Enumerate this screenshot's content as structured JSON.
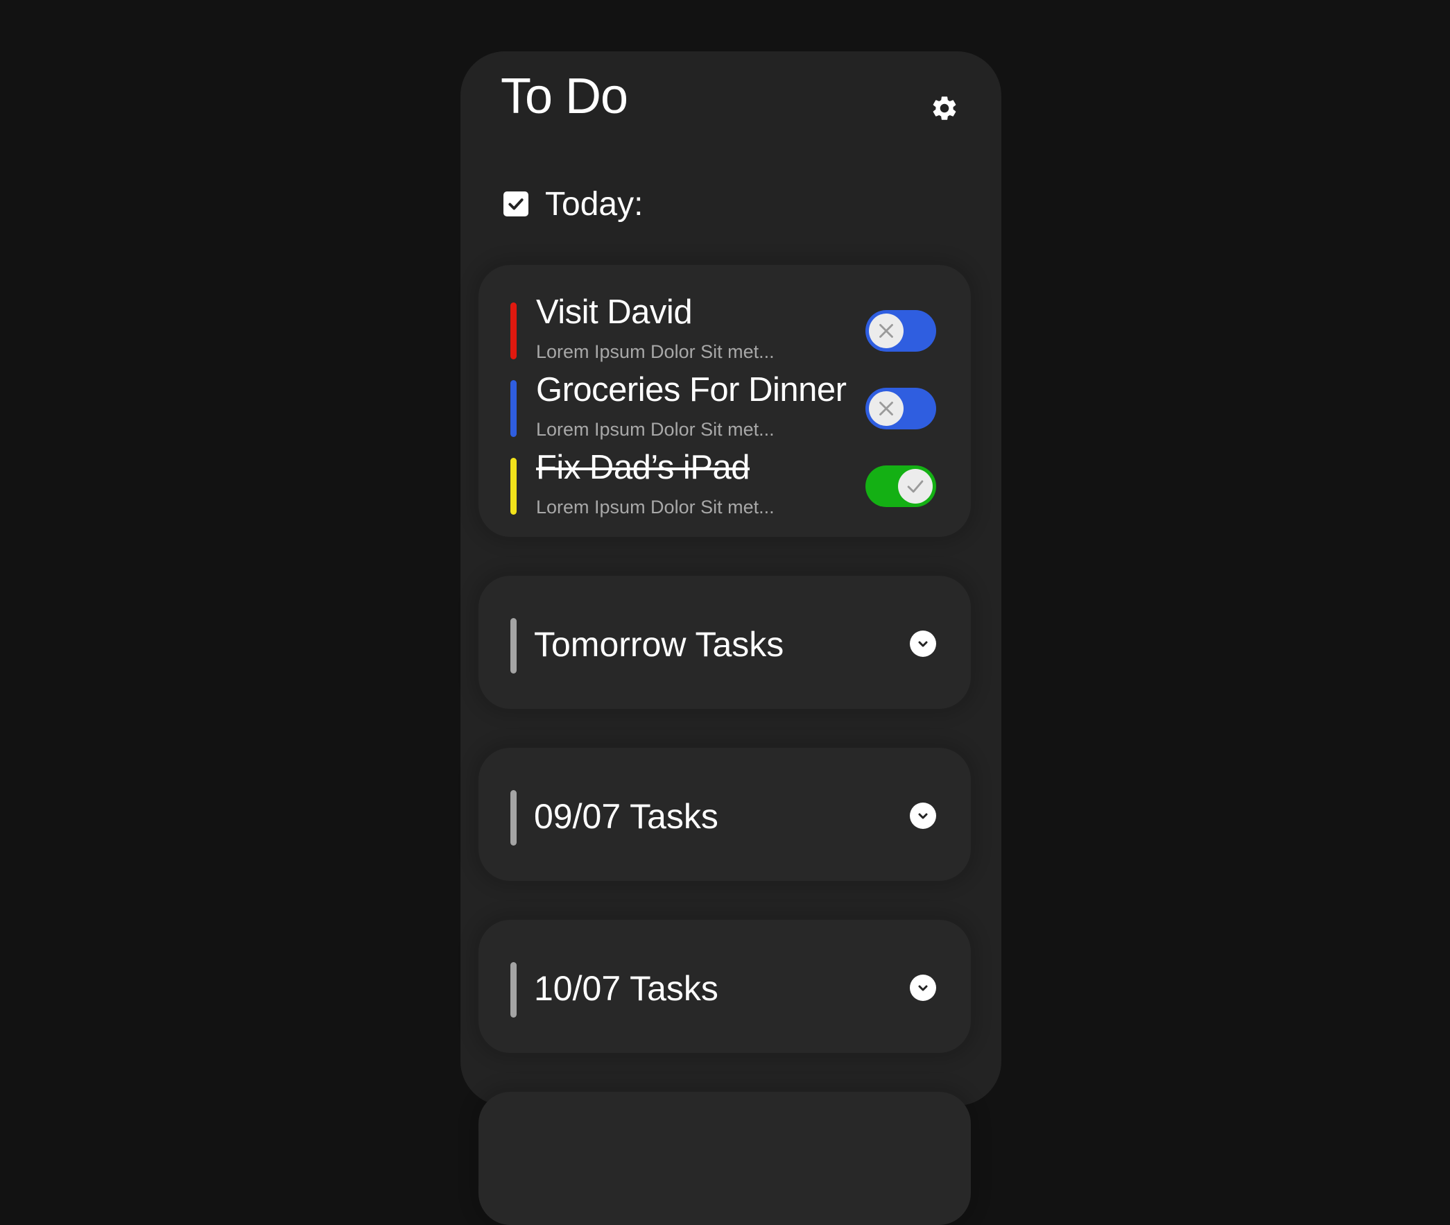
{
  "app": {
    "title": "To Do",
    "settings_icon": "gear-icon"
  },
  "today": {
    "label": "Today:",
    "icon": "checkbox-checked-icon",
    "tasks": [
      {
        "title": "Visit David",
        "description": "Lorem Ipsum Dolor Sit met...",
        "color": "#e0190f",
        "completed": false,
        "toggle_icon": "x-icon"
      },
      {
        "title": "Groceries For Dinner",
        "description": "Lorem Ipsum Dolor Sit met...",
        "color": "#2f5ee0",
        "completed": false,
        "toggle_icon": "x-icon"
      },
      {
        "title": "Fix Dad’s iPad",
        "description": "Lorem Ipsum Dolor Sit met...",
        "color": "#f2e21b",
        "completed": true,
        "toggle_icon": "check-icon"
      }
    ]
  },
  "groups": [
    {
      "title": "Tomorrow Tasks",
      "icon": "chevron-down-icon"
    },
    {
      "title": "09/07 Tasks",
      "icon": "chevron-down-icon"
    },
    {
      "title": "10/07 Tasks",
      "icon": "chevron-down-icon"
    }
  ],
  "colors": {
    "background": "#121212",
    "panel": "#232323",
    "card": "#282828",
    "toggle_off": "#2f5ee0",
    "toggle_on": "#14b014"
  }
}
